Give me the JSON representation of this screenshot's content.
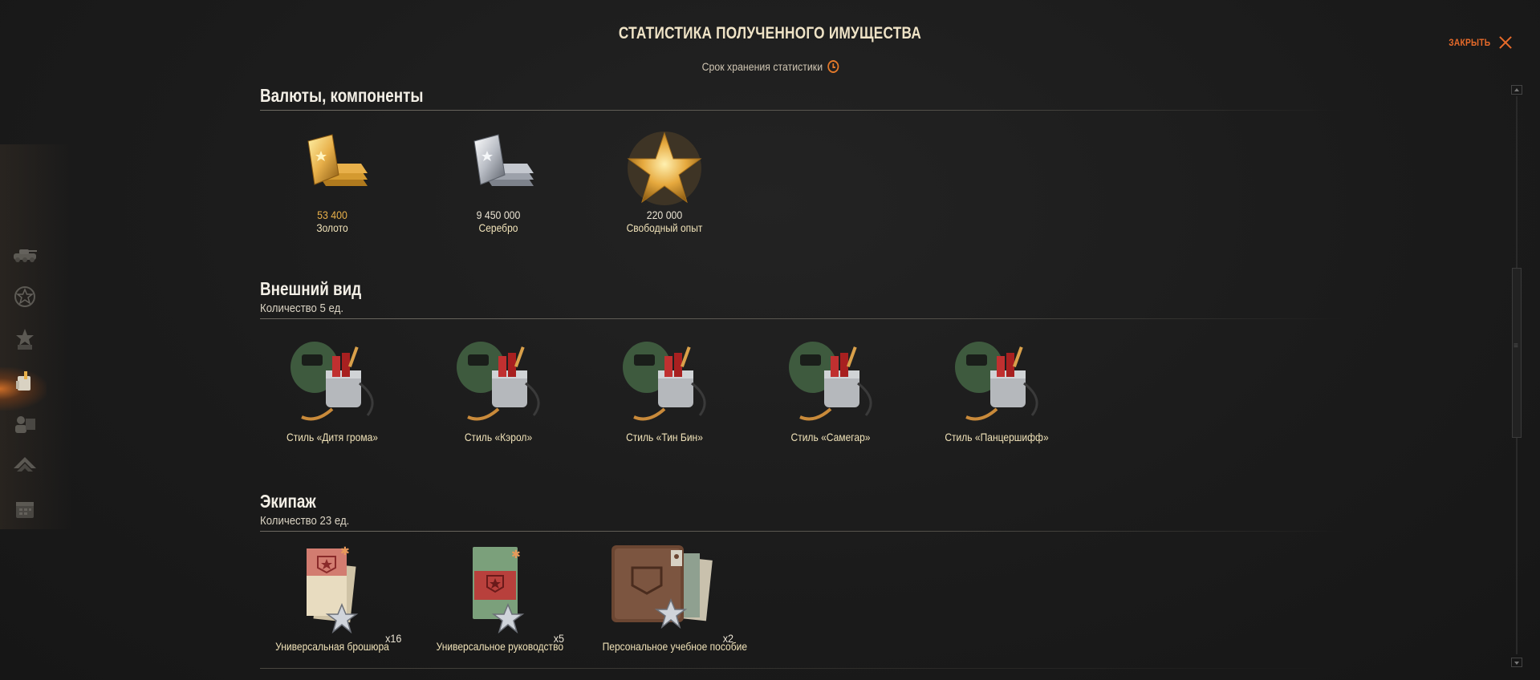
{
  "header": {
    "title": "СТАТИСТИКА ПОЛУЧЕННОГО ИМУЩЕСТВА",
    "subtitle": "Срок хранения статистики",
    "close_label": "ЗАКРЫТЬ"
  },
  "sidebar": {
    "items": [
      {
        "icon": "vehicle-icon"
      },
      {
        "icon": "achievements-icon"
      },
      {
        "icon": "rewards-icon"
      },
      {
        "icon": "customization-icon",
        "active": true
      },
      {
        "icon": "crew-icon"
      },
      {
        "icon": "upgrade-icon"
      },
      {
        "icon": "calendar-icon"
      }
    ]
  },
  "sections": {
    "currencies": {
      "title": "Валюты, компоненты",
      "items": [
        {
          "value": "53 400",
          "label": "Золото",
          "value_color": "#e8b04a",
          "icon": "gold-bars-icon"
        },
        {
          "value": "9 450 000",
          "label": "Серебро",
          "value_color": "#e9e2d2",
          "icon": "silver-bars-icon"
        },
        {
          "value": "220 000",
          "label": "Свободный опыт",
          "value_color": "#e9e2d2",
          "icon": "free-xp-star-icon"
        }
      ]
    },
    "appearance": {
      "title": "Внешний вид",
      "count": "Количество 5 ед.",
      "items": [
        {
          "label": "Стиль «Дитя грома»"
        },
        {
          "label": "Стиль «Кэрол»"
        },
        {
          "label": "Стиль «Тин Бин»"
        },
        {
          "label": "Стиль «Самегар»"
        },
        {
          "label": "Стиль «Панцершифф»"
        }
      ]
    },
    "crew": {
      "title": "Экипаж",
      "count": "Количество 23 ед.",
      "items": [
        {
          "label": "Универсальная брошюра",
          "qty": "x16"
        },
        {
          "label": "Универсальное руководство",
          "qty": "x5"
        },
        {
          "label": "Персональное учебное пособие",
          "qty": "x2"
        }
      ]
    }
  },
  "colors": {
    "accent_orange": "#e86b2a",
    "gold": "#e8b04a",
    "background": "#1b1b1b"
  }
}
